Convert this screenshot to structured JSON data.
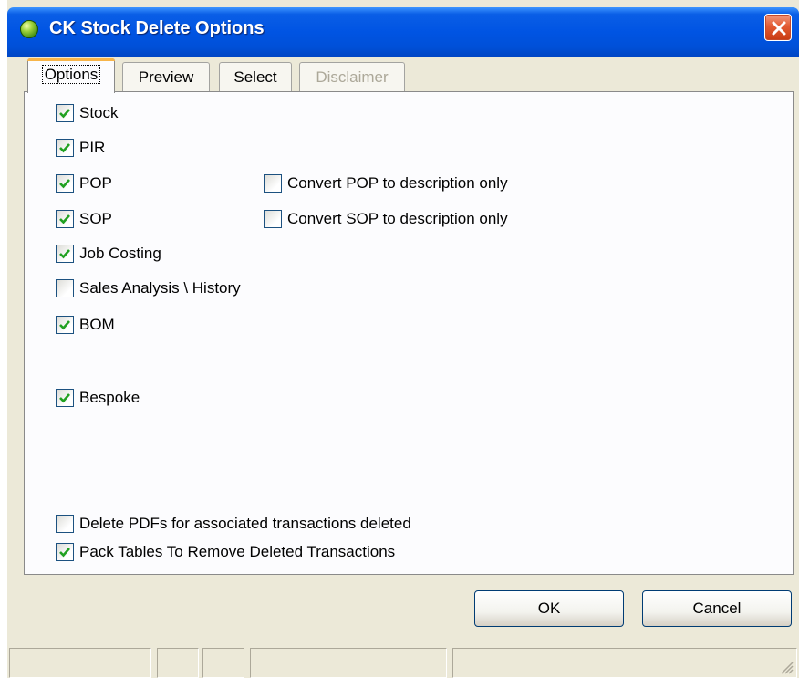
{
  "window": {
    "title": "CK Stock Delete Options",
    "title_bar_color": "#0054e3"
  },
  "tabs": [
    {
      "label": "Options",
      "state": "active"
    },
    {
      "label": "Preview",
      "state": "normal"
    },
    {
      "label": "Select",
      "state": "normal"
    },
    {
      "label": "Disclaimer",
      "state": "disabled"
    }
  ],
  "options": {
    "stock": {
      "label": "Stock",
      "checked": true
    },
    "pir": {
      "label": "PIR",
      "checked": true
    },
    "pop": {
      "label": "POP",
      "checked": true
    },
    "convert_pop": {
      "label": "Convert POP to description only",
      "checked": false
    },
    "sop": {
      "label": "SOP",
      "checked": true
    },
    "convert_sop": {
      "label": "Convert SOP to description only",
      "checked": false
    },
    "job_costing": {
      "label": "Job Costing",
      "checked": true
    },
    "sales_analysis": {
      "label": "Sales Analysis \\ History",
      "checked": false
    },
    "bom": {
      "label": "BOM",
      "checked": true
    },
    "bespoke": {
      "label": "Bespoke",
      "checked": true
    },
    "delete_pdfs": {
      "label": "Delete PDFs for associated transactions deleted",
      "checked": false
    },
    "pack_tables": {
      "label": "Pack Tables To  Remove Deleted Transactions",
      "checked": true
    }
  },
  "buttons": {
    "ok": "OK",
    "cancel": "Cancel"
  },
  "icons": {
    "app": "green-orb-icon",
    "close": "close-icon",
    "checkmark": "checkmark-icon",
    "grip": "resize-grip-icon"
  },
  "colors": {
    "checkmark": "#21a121",
    "close_button": "#e35b32",
    "active_tab_accent": "#f7b54a"
  }
}
